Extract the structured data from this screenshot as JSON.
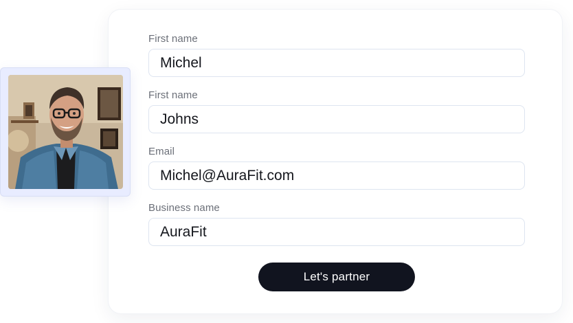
{
  "form": {
    "fields": [
      {
        "label": "First name",
        "value": "Michel"
      },
      {
        "label": "First name",
        "value": "Johns"
      },
      {
        "label": "Email",
        "value": "Michel@AuraFit.com"
      },
      {
        "label": "Business name",
        "value": "AuraFit"
      }
    ],
    "submit_label": "Let's partner"
  },
  "colors": {
    "button_bg": "#11141f",
    "photo_frame": "#e8ecff",
    "input_border": "#dde4f0"
  }
}
